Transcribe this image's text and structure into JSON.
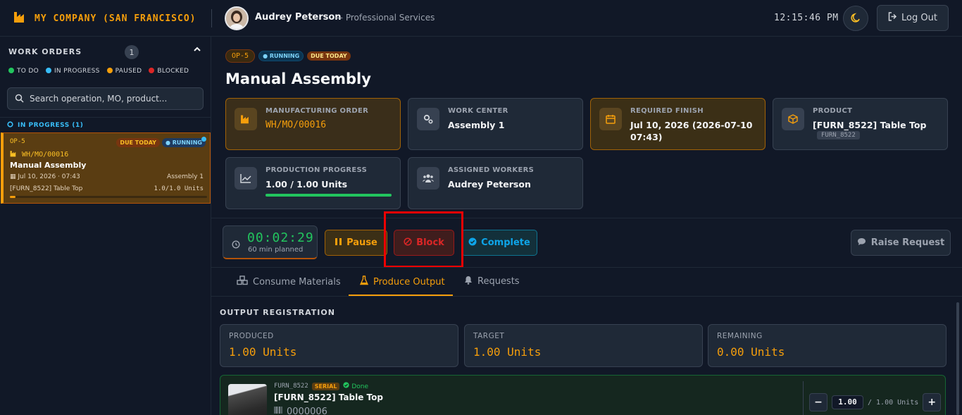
{
  "header": {
    "company": "MY COMPANY (SAN FRANCISCO)",
    "user_name": "Audrey Peterson",
    "user_role": "— Professional Services",
    "clock": "12:15:46 PM",
    "logout_label": "Log Out"
  },
  "sidebar": {
    "title": "WORK ORDERS",
    "count": "1",
    "legend": [
      {
        "label": "TO DO",
        "color": "#22c55e"
      },
      {
        "label": "IN PROGRESS",
        "color": "#38bdf8"
      },
      {
        "label": "PAUSED",
        "color": "#f59e0b"
      },
      {
        "label": "BLOCKED",
        "color": "#dc2626"
      }
    ],
    "search_placeholder": "Search operation, MO, product...",
    "section": "IN PROGRESS (1)",
    "card": {
      "code": "OP-5",
      "due": "DUE TODAY",
      "status": "RUNNING",
      "mo": "WH/MO/00016",
      "name": "Manual Assembly",
      "date": "Jul 10, 2026 · 07:43",
      "center": "Assembly 1",
      "product": "[FURN_8522] Table Top",
      "qty": "1.0/1.0 Units",
      "progress": 0.03
    }
  },
  "main": {
    "op_code": "OP-5",
    "status": "RUNNING",
    "due": "DUE TODAY",
    "title": "Manual Assembly",
    "info": {
      "mo_label": "MANUFACTURING ORDER",
      "mo_value": "WH/MO/00016",
      "wc_label": "WORK CENTER",
      "wc_value": "Assembly 1",
      "finish_label": "REQUIRED FINISH",
      "finish_value": "Jul 10, 2026 (2026-07-10 07:43)",
      "product_label": "PRODUCT",
      "product_value": "[FURN_8522] Table Top",
      "product_code": "FURN_8522",
      "progress_label": "PRODUCTION PROGRESS",
      "progress_value": "1.00 / 1.00 Units",
      "progress_fraction": 1.0,
      "workers_label": "ASSIGNED WORKERS",
      "workers_value": "Audrey Peterson"
    },
    "timer": {
      "value": "00:02:29",
      "planned": "60 min planned"
    },
    "actions": {
      "pause": "Pause",
      "block": "Block",
      "complete": "Complete",
      "raise": "Raise Request"
    },
    "tabs": [
      {
        "label": "Consume Materials"
      },
      {
        "label": "Produce Output"
      },
      {
        "label": "Requests"
      }
    ],
    "output": {
      "title": "OUTPUT REGISTRATION",
      "produced_label": "PRODUCED",
      "produced_value": "1.00 Units",
      "target_label": "TARGET",
      "target_value": "1.00 Units",
      "remaining_label": "REMAINING",
      "remaining_value": "0.00 Units",
      "line": {
        "code": "FURN_8522",
        "tracking": "SERIAL",
        "state": "Done",
        "name": "[FURN_8522] Table Top",
        "serial": "0000006",
        "qty": "1.00",
        "of": "/ 1.00 Units"
      }
    }
  },
  "colors": {
    "accent": "#f59e0b",
    "running": "#38bdf8",
    "success": "#22c55e",
    "danger": "#dc2626"
  }
}
